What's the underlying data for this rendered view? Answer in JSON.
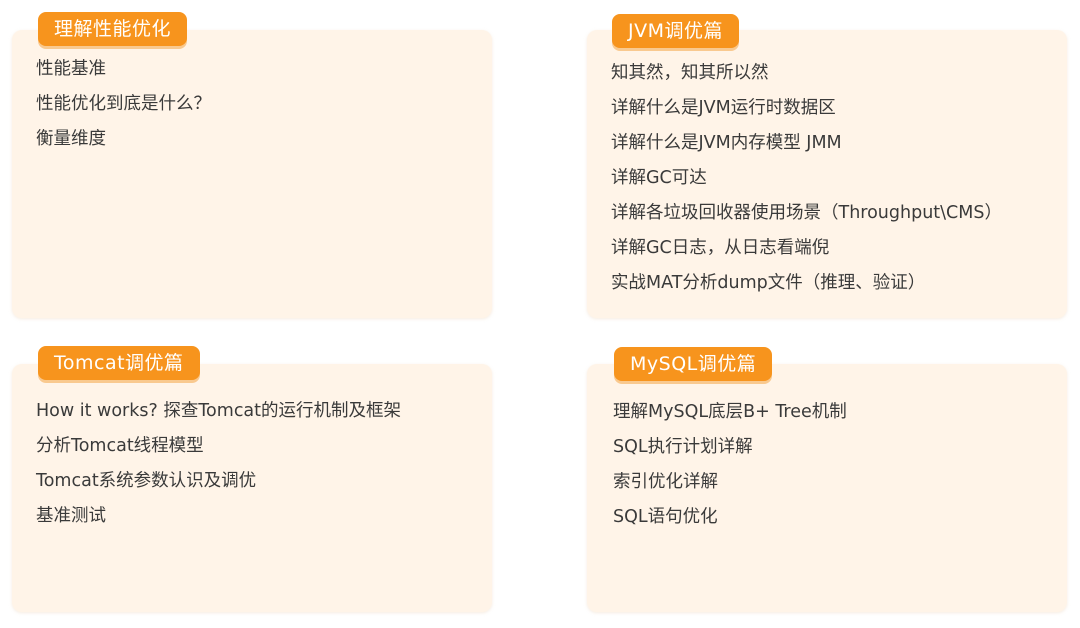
{
  "sections": [
    {
      "title": "理解性能优化",
      "items": [
        "性能基准",
        "性能优化到底是什么？",
        "衡量维度"
      ]
    },
    {
      "title": "JVM调优篇",
      "items": [
        "知其然，知其所以然",
        "详解什么是JVM运行时数据区",
        "详解什么是JVM内存模型 JMM",
        "详解GC可达",
        "详解各垃圾回收器使用场景（Throughput\\CMS）",
        "详解GC日志，从日志看端倪",
        "实战MAT分析dump文件（推理、验证）"
      ]
    },
    {
      "title": "Tomcat调优篇",
      "items": [
        "How it works? 探查Tomcat的运行机制及框架",
        "分析Tomcat线程模型",
        "Tomcat系统参数认识及调优",
        "基准测试"
      ]
    },
    {
      "title": "MySQL调优篇",
      "items": [
        "理解MySQL底层B+ Tree机制",
        "SQL执行计划详解",
        "索引优化详解",
        "SQL语句优化"
      ]
    }
  ],
  "colors": {
    "tag_background": "#f7941d",
    "card_background": "#fff4e8",
    "text": "#3a3a3a"
  }
}
